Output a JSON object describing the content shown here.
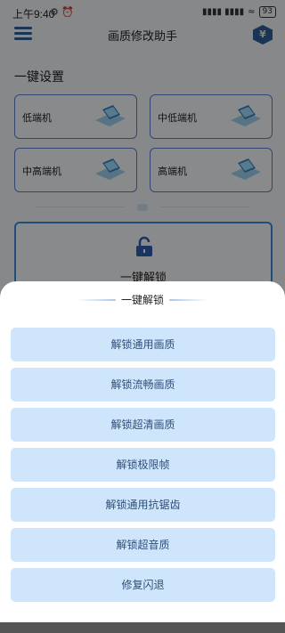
{
  "status_bar": {
    "time": "上午9:40",
    "signal": "▮▮▮▮ ▮▮▮▮",
    "wifi": "≈",
    "battery": "93"
  },
  "header": {
    "title": "画质修改助手"
  },
  "section": {
    "title": "一键设置"
  },
  "presets": [
    {
      "label": "低端机"
    },
    {
      "label": "中低端机"
    },
    {
      "label": "中高端机"
    },
    {
      "label": "高端机"
    }
  ],
  "unlock_card": {
    "label": "一键解锁"
  },
  "sheet": {
    "title": "一键解锁",
    "options": [
      {
        "label": "解锁通用画质"
      },
      {
        "label": "解锁流畅画质"
      },
      {
        "label": "解锁超清画质"
      },
      {
        "label": "解锁极限帧"
      },
      {
        "label": "解锁通用抗锯齿"
      },
      {
        "label": "解锁超音质"
      },
      {
        "label": "修复闪退"
      }
    ]
  },
  "icons": {
    "menu": "hamburger-icon",
    "currency": "yen-icon",
    "lock": "unlock-icon",
    "device": "phone-device-icon"
  },
  "colors": {
    "accent": "#2f5f9a",
    "card_border": "#5b7fd6",
    "option_bg": "#cfe5fb",
    "option_text": "#2f4f7a"
  }
}
